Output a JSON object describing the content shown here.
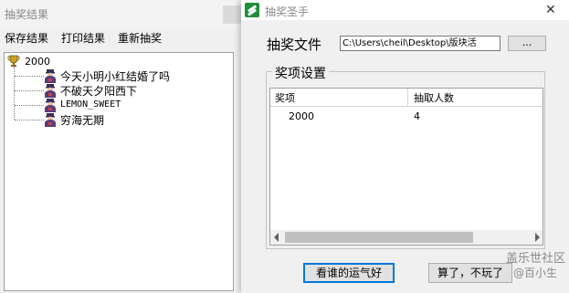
{
  "left_window": {
    "title": "抽奖结果",
    "menu": [
      "保存结果",
      "打印结果",
      "重新抽奖"
    ],
    "tree": {
      "root": "2000",
      "children": [
        "今天小明小红结婚了吗",
        "不破天夕阳西下",
        "LEMON_SWEET",
        "穷海无期"
      ]
    }
  },
  "right_window": {
    "title": "抽奖圣手",
    "close": "✕",
    "file_label": "抽奖文件",
    "file_path": "C:\\Users\\cheil\\Desktop\\版块活",
    "browse_label": "...",
    "group_label": "奖项设置",
    "columns": [
      "奖项",
      "抽取人数"
    ],
    "rows": [
      [
        "2000",
        "4"
      ]
    ],
    "draw_button": "看谁的运气好",
    "cancel_button": "算了，不玩了"
  },
  "watermark": {
    "line1": "盖乐世社区",
    "line2": "@百小生"
  }
}
